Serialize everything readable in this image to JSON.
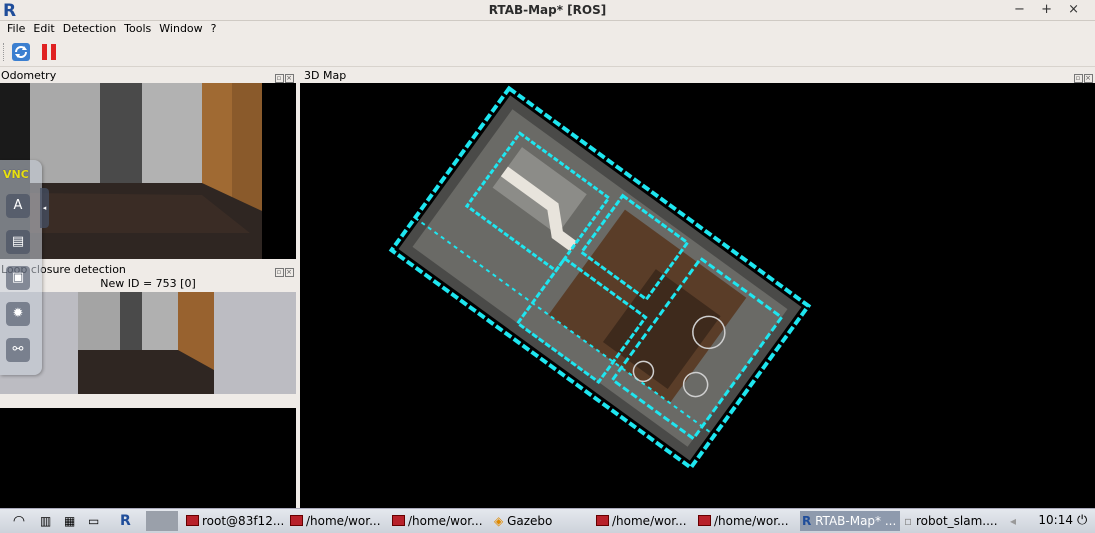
{
  "window": {
    "title": "RTAB-Map* [ROS]",
    "logo": "R",
    "controls": "− + ×"
  },
  "menu": [
    "File",
    "Edit",
    "Detection",
    "Tools",
    "Window",
    "?"
  ],
  "toolbar": {
    "icons": [
      "refresh-icon",
      "pause-icon"
    ]
  },
  "panels": {
    "odometry": {
      "title": "Odometry"
    },
    "map3d": {
      "title": "3D Map"
    },
    "loop_closure": {
      "title": "Loop closure detection",
      "caption": "New ID = 753 [0]"
    }
  },
  "vnc": {
    "logo": "VNC",
    "buttons": [
      "keyboard-icon",
      "clipboard-icon",
      "screenshot-icon",
      "settings-icon",
      "disconnect-icon"
    ]
  },
  "taskbar": {
    "items": [
      "root@83f12...",
      "/home/wor...",
      "/home/wor...",
      "Gazebo",
      "/home/wor...",
      "/home/wor...",
      "RTAB-Map* ...",
      "robot_slam...."
    ],
    "clock": "10:14"
  },
  "colors": {
    "map_accent": "#1ee6f0",
    "wall": "#a6a6a6",
    "door": "#8a5a2b",
    "floor": "#3a2a22"
  }
}
